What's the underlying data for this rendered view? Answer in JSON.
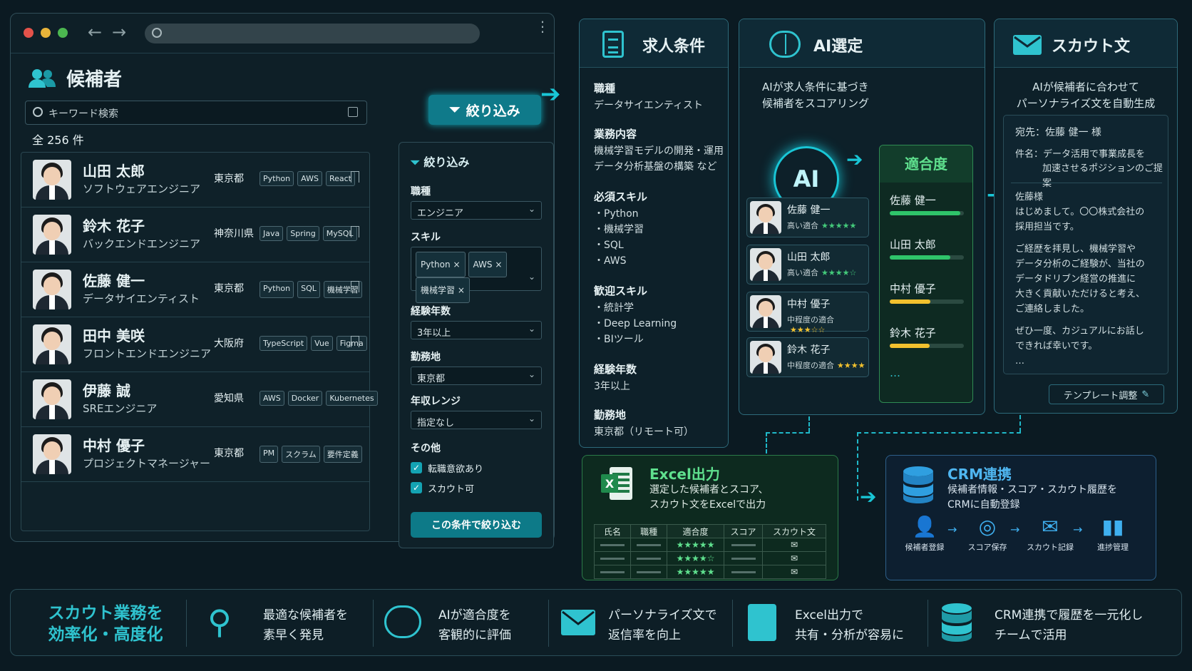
{
  "candidates": {
    "title": "候補者",
    "search_placeholder": "キーワード検索",
    "count": "全 256 件",
    "rows": [
      {
        "name": "山田 太郎",
        "role": "ソフトウェアエンジニア",
        "location": "東京都",
        "tags": [
          "Python",
          "AWS",
          "React"
        ]
      },
      {
        "name": "鈴木 花子",
        "role": "バックエンドエンジニア",
        "location": "神奈川県",
        "tags": [
          "Java",
          "Spring",
          "MySQL"
        ]
      },
      {
        "name": "佐藤 健一",
        "role": "データサイエンティスト",
        "location": "東京都",
        "tags": [
          "Python",
          "SQL",
          "機械学習"
        ]
      },
      {
        "name": "田中 美咲",
        "role": "フロントエンドエンジニア",
        "location": "大阪府",
        "tags": [
          "TypeScript",
          "Vue",
          "Figma"
        ]
      },
      {
        "name": "伊藤 誠",
        "role": "SREエンジニア",
        "location": "愛知県",
        "tags": [
          "AWS",
          "Docker",
          "Kubernetes"
        ]
      },
      {
        "name": "中村 優子",
        "role": "プロジェクトマネージャー",
        "location": "東京都",
        "tags": [
          "PM",
          "スクラム",
          "要件定義"
        ]
      }
    ]
  },
  "filter_button": "絞り込み",
  "filter": {
    "title": "絞り込み",
    "job_label": "職種",
    "job_value": "エンジニア",
    "skill_label": "スキル",
    "skills": [
      "Python",
      "AWS",
      "機械学習"
    ],
    "exp_label": "経験年数",
    "exp_value": "3年以上",
    "loc_label": "勤務地",
    "loc_value": "東京都",
    "salary_label": "年収レンジ",
    "salary_value": "指定なし",
    "other_label": "その他",
    "check1": "転職意欲あり",
    "check2": "スカウト可",
    "apply": "この条件で絞り込む"
  },
  "job": {
    "title": "求人条件",
    "role_label": "職種",
    "role_value": "データサイエンティスト",
    "duty_label": "業務内容",
    "duty_line1": "機械学習モデルの開発・運用",
    "duty_line2": "データ分析基盤の構築 など",
    "req_label": "必須スキル",
    "req": [
      "・Python",
      "・機械学習",
      "・SQL",
      "・AWS"
    ],
    "pref_label": "歓迎スキル",
    "pref": [
      "・統計学",
      "・Deep Learning",
      "・BIツール"
    ],
    "exp_label": "経験年数",
    "exp_value": "3年以上",
    "loc_label": "勤務地",
    "loc_value": "東京都（リモート可）"
  },
  "ai": {
    "title": "AI選定",
    "desc1": "AIが求人条件に基づき",
    "desc2": "候補者をスコアリング",
    "logo": "AI",
    "cards": [
      {
        "name": "佐藤 健一",
        "level": "高い適合",
        "stars": "★★★★★"
      },
      {
        "name": "山田 太郎",
        "level": "高い適合",
        "stars": "★★★★☆"
      },
      {
        "name": "中村 優子",
        "level": "中程度の適合",
        "stars": "★★★☆☆"
      },
      {
        "name": "鈴木 花子",
        "level": "中程度の適合",
        "stars": "★★★★"
      }
    ],
    "fit_title": "適合度",
    "fit": [
      {
        "name": "佐藤 健一",
        "score": 0.95
      },
      {
        "name": "山田 太郎",
        "score": 0.82
      },
      {
        "name": "中村 優子",
        "score": 0.55
      },
      {
        "name": "鈴木 花子",
        "score": 0.54
      }
    ],
    "more": "…",
    "colors": {
      "high": "#2fc46a",
      "mid": "#f2c12e"
    }
  },
  "scout": {
    "title": "スカウト文",
    "desc1": "AIが候補者に合わせて",
    "desc2": "パーソナライズ文を自動生成",
    "to": "宛先：佐藤 健一 様",
    "subject1": "件名：データ活用で事業成長を",
    "subject2": "加速させるポジションのご提案",
    "body": [
      "佐藤様",
      "はじめまして。〇〇株式会社の",
      "採用担当です。",
      "",
      "ご経歴を拝見し、機械学習や",
      "データ分析のご経験が、当社の",
      "データドリブン経営の推進に",
      "大きく貢献いただけると考え、",
      "ご連絡しました。",
      "",
      "ぜひ一度、カジュアルにお話し",
      "できれば幸いです。",
      "…"
    ],
    "template_button": "テンプレート調整"
  },
  "excel": {
    "title": "Excel出力",
    "desc1": "選定した候補者とスコア、",
    "desc2": "スカウト文をExcelで出力",
    "headers": [
      "氏名",
      "職種",
      "適合度",
      "スコア",
      "スカウト文"
    ],
    "stars": [
      "★★★★★",
      "★★★★☆",
      "★★★★★"
    ]
  },
  "crm": {
    "title": "CRM連携",
    "desc1": "候補者情報・スコア・スカウト履歴を",
    "desc2": "CRMに自動登録",
    "steps": [
      "候補者登録",
      "スコア保存",
      "スカウト記録",
      "進捗管理"
    ]
  },
  "footer": {
    "headline1": "スカウト業務を",
    "headline2": "効率化・高度化",
    "items": [
      {
        "l1": "最適な候補者を",
        "l2": "素早く発見"
      },
      {
        "l1": "AIが適合度を",
        "l2": "客観的に評価"
      },
      {
        "l1": "パーソナライズ文で",
        "l2": "返信率を向上"
      },
      {
        "l1": "Excel出力で",
        "l2": "共有・分析が容易に"
      },
      {
        "l1": "CRM連携で履歴を一元化し",
        "l2": "チームで活用"
      }
    ]
  }
}
